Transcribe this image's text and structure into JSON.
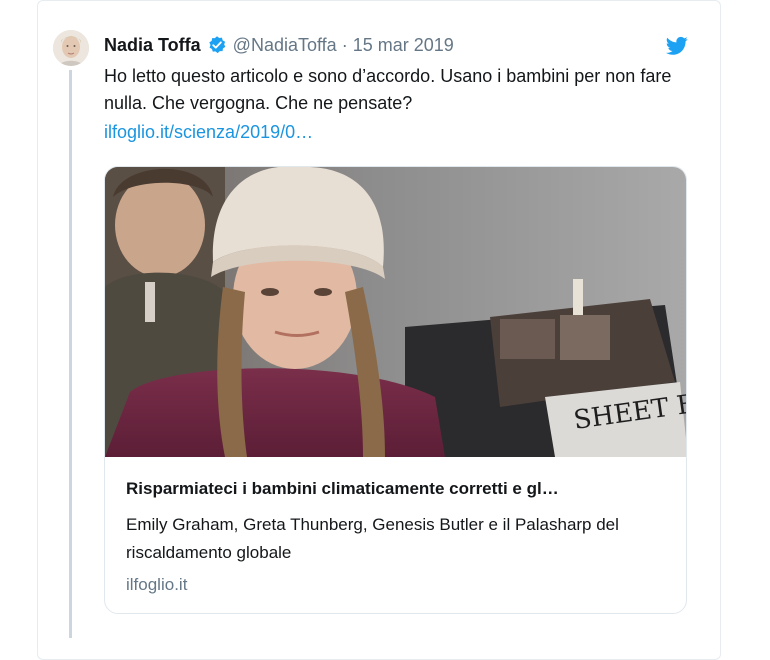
{
  "tweet": {
    "author_name": "Nadia Toffa",
    "handle": "@NadiaToffa",
    "separator": "·",
    "date": "15 mar 2019",
    "text": "Ho letto questo articolo e sono d’accordo. Usano i bambini per non fare nulla. Che vergogna. Che ne pensate?",
    "link_text": "ilfoglio.it/scienza/2019/0…",
    "icons": {
      "avatar": "avatar-photo",
      "verified": "verified-badge-icon",
      "brand": "twitter-bird-icon"
    },
    "colors": {
      "link": "#1b95e0",
      "verified": "#1da1f2",
      "muted": "#657786"
    }
  },
  "card": {
    "title": "Risparmiateci i bambini climaticamente corretti e gl…",
    "description": "Emily Graham, Greta Thunberg, Genesis Butler e il Palasharp del riscaldamento globale",
    "domain": "ilfoglio.it",
    "image_caption_text": "SHEET BAND"
  }
}
